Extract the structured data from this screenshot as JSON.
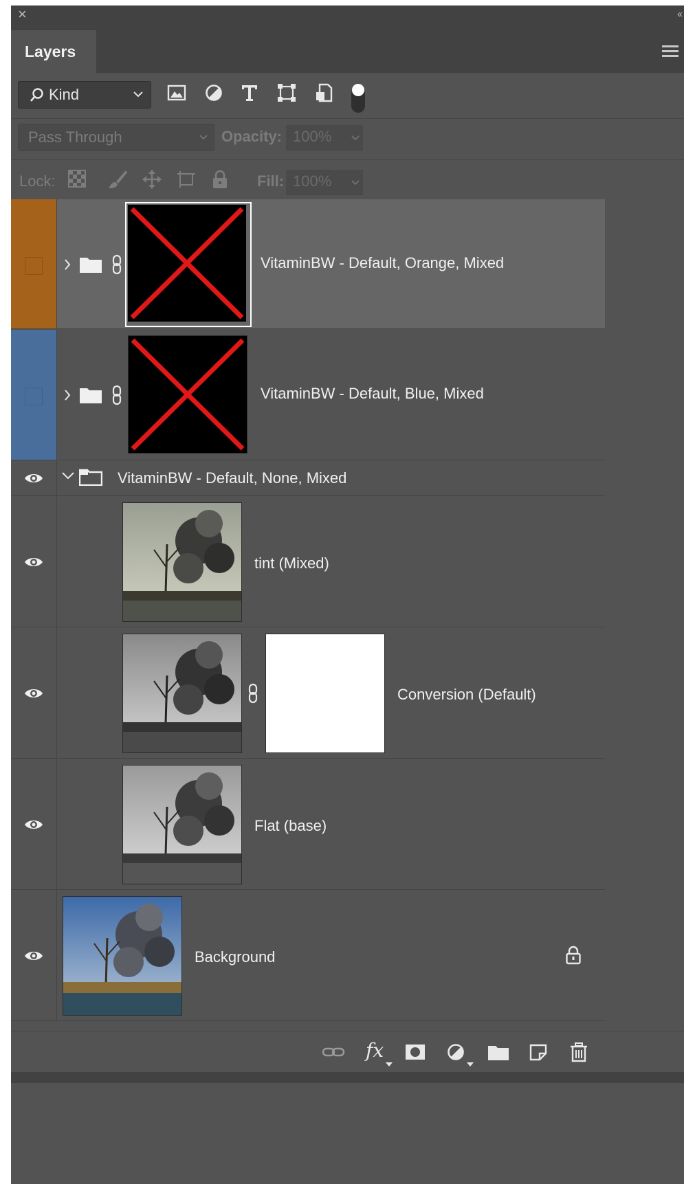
{
  "window": {
    "close_glyph": "×",
    "collapse_glyph": "‹‹"
  },
  "tabs": [
    {
      "label": "Layers"
    }
  ],
  "filter": {
    "kind_label": "Kind",
    "icons": [
      "image-filter-icon",
      "adjustment-filter-icon",
      "type-filter-icon",
      "shape-filter-icon",
      "smart-object-filter-icon",
      "filter-toggle"
    ]
  },
  "blend": {
    "mode": "Pass Through",
    "opacity_label": "Opacity:",
    "opacity_value": "100%"
  },
  "lock": {
    "label": "Lock:",
    "fill_label": "Fill:",
    "fill_value": "100%"
  },
  "layers": [
    {
      "name": "VitaminBW - Default, Orange, Mixed",
      "type": "group",
      "visible": false,
      "color": "#a5621b",
      "expanded": false,
      "selected": true,
      "thumb": "missing"
    },
    {
      "name": "VitaminBW - Default, Blue, Mixed",
      "type": "group",
      "visible": false,
      "color": "#4a6e9c",
      "expanded": false,
      "selected": false,
      "thumb": "missing"
    },
    {
      "name": "VitaminBW - Default, None, Mixed",
      "type": "group",
      "visible": true,
      "expanded": true
    },
    {
      "name": "tint (Mixed)",
      "type": "layer",
      "visible": true,
      "thumb": "tinted"
    },
    {
      "name": "Conversion (Default)",
      "type": "layer",
      "visible": true,
      "thumb": "bw",
      "mask": "white"
    },
    {
      "name": "Flat (base)",
      "type": "layer",
      "visible": true,
      "thumb": "bw"
    },
    {
      "name": "Background",
      "type": "layer",
      "visible": true,
      "thumb": "color",
      "locked": true
    }
  ],
  "bottom_toolbar": [
    "link-layers-icon",
    "fx-icon",
    "add-mask-icon",
    "new-adjustment-icon",
    "new-group-icon",
    "new-layer-icon",
    "delete-layer-icon"
  ],
  "fx_label": "fx",
  "colors": {
    "panel": "#535353",
    "selected_row": "#666666",
    "orange_tag": "#a5621b",
    "blue_tag": "#4a6e9c"
  }
}
